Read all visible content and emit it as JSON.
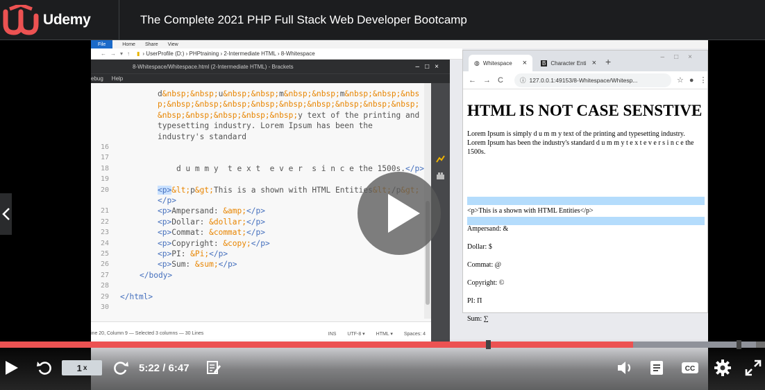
{
  "header": {
    "brand": "Udemy",
    "course_title": "The Complete 2021 PHP Full Stack Web Developer Bootcamp"
  },
  "explorer": {
    "file_tab": "File",
    "menus": [
      "Home",
      "Share",
      "View"
    ],
    "path": "›  UserProfile (D:)  ›  PHPtraining  ›  2-Intermediate HTML  ›  8-Whitespace"
  },
  "brackets": {
    "title": "8-Whitespace/Whitespace.html (2-Intermediate HTML) - Brackets",
    "menus": [
      "ebug",
      "Help"
    ],
    "lines": [
      {
        "n": "",
        "html": "d<span class='ent'>&amp;nbsp;&amp;nbsp;</span>u<span class='ent'>&amp;nbsp;&amp;nbsp;</span>m<span class='ent'>&amp;nbsp;&amp;nbsp;</span>m<span class='ent'>&amp;nbsp;&amp;nbsp;&amp;nbs</span>"
      },
      {
        "n": "",
        "html": "<span class='ent'>p;&amp;nbsp;&amp;nbsp;&amp;nbsp;&amp;nbsp;&amp;nbsp;&amp;nbsp;&amp;nbsp;&amp;nbsp;&amp;nbsp;</span>"
      },
      {
        "n": "",
        "html": "<span class='ent'>&amp;nbsp;&amp;nbsp;&amp;nbsp;&amp;nbsp;&amp;nbsp;</span>y text of the printing and"
      },
      {
        "n": "",
        "html": "typesetting industry. Lorem Ipsum has been the"
      },
      {
        "n": "",
        "html": "industry's standard"
      },
      {
        "n": "16",
        "html": ""
      },
      {
        "n": "17",
        "html": ""
      },
      {
        "n": "18",
        "html": "    d u m m y  t e x t  e v e r  s i n c e the 1500s.<span class='tag'>&lt;/p&gt;</span>"
      },
      {
        "n": "19",
        "html": ""
      },
      {
        "n": "20",
        "html": "<span class='tag sel'>&lt;p&gt;</span><span class='ent'>&amp;lt;</span>p<span class='ent'>&amp;gt;</span>This is a shown with HTML Entities<span class='ent'>&amp;lt;</span>/p<span class='ent'>&amp;gt;</span>"
      },
      {
        "n": "",
        "html": "<span class='tag'>&lt;/p&gt;</span>"
      },
      {
        "n": "21",
        "html": "<span class='tag'>&lt;p&gt;</span>Ampersand: <span class='ent'>&amp;amp;</span><span class='tag'>&lt;/p&gt;</span>"
      },
      {
        "n": "22",
        "html": "<span class='tag'>&lt;p&gt;</span>Dollar: <span class='ent'>&amp;dollar;</span><span class='tag'>&lt;/p&gt;</span>"
      },
      {
        "n": "23",
        "html": "<span class='tag'>&lt;p&gt;</span>Commat: <span class='ent'>&amp;commat;</span><span class='tag'>&lt;/p&gt;</span>"
      },
      {
        "n": "24",
        "html": "<span class='tag'>&lt;p&gt;</span>Copyright: <span class='ent'>&amp;copy;</span><span class='tag'>&lt;/p&gt;</span>"
      },
      {
        "n": "25",
        "html": "<span class='tag'>&lt;p&gt;</span>PI: <span class='ent'>&amp;Pi;</span><span class='tag'>&lt;/p&gt;</span>"
      },
      {
        "n": "26",
        "html": "<span class='tag'>&lt;p&gt;</span>Sum: <span class='ent'>&amp;sum;</span><span class='tag'>&lt;/p&gt;</span>"
      },
      {
        "n": "27",
        "html": "<span class='tag'>&lt;/body&gt;</span>"
      },
      {
        "n": "28",
        "html": ""
      },
      {
        "n": "29",
        "html": "<span class='tag'>&lt;/html&gt;</span>"
      },
      {
        "n": "30",
        "html": ""
      }
    ],
    "status_left": "ine 20, Column 9 — Selected 3 columns — 30 Lines",
    "status_ins": "INS",
    "status_enc": "UTF-8 ▾",
    "status_lang": "HTML ▾",
    "status_spaces": "Spaces: 4"
  },
  "chrome": {
    "tab1": "Whitespace",
    "tab2": "Character Enti",
    "url": "127.0.0.1:49153/8-Whitespace/Whitesp...",
    "heading": "HTML IS NOT CASE SENSTIVE",
    "lorem": "Lorem Ipsum is simply d u m m                y text of the printing and typesetting industry. Lorem Ipsum has been the industry's standard d u m m y t e x t e v e r s i n c e the 1500s.",
    "entity_line": "<p>This is a shown with HTML Entities</p>",
    "ampersand": "Ampersand: &",
    "dollar": "Dollar: $",
    "commat": "Commat: @",
    "copyright": "Copyright: ©",
    "pi": "PI: Π",
    "sum": "Sum: ∑"
  },
  "player": {
    "speed": "1",
    "speed_suffix": "x",
    "time": "5:22 / 6:47",
    "progress_played": 0.828,
    "progress_buffered": 0.988,
    "accent": "#ec5252"
  }
}
